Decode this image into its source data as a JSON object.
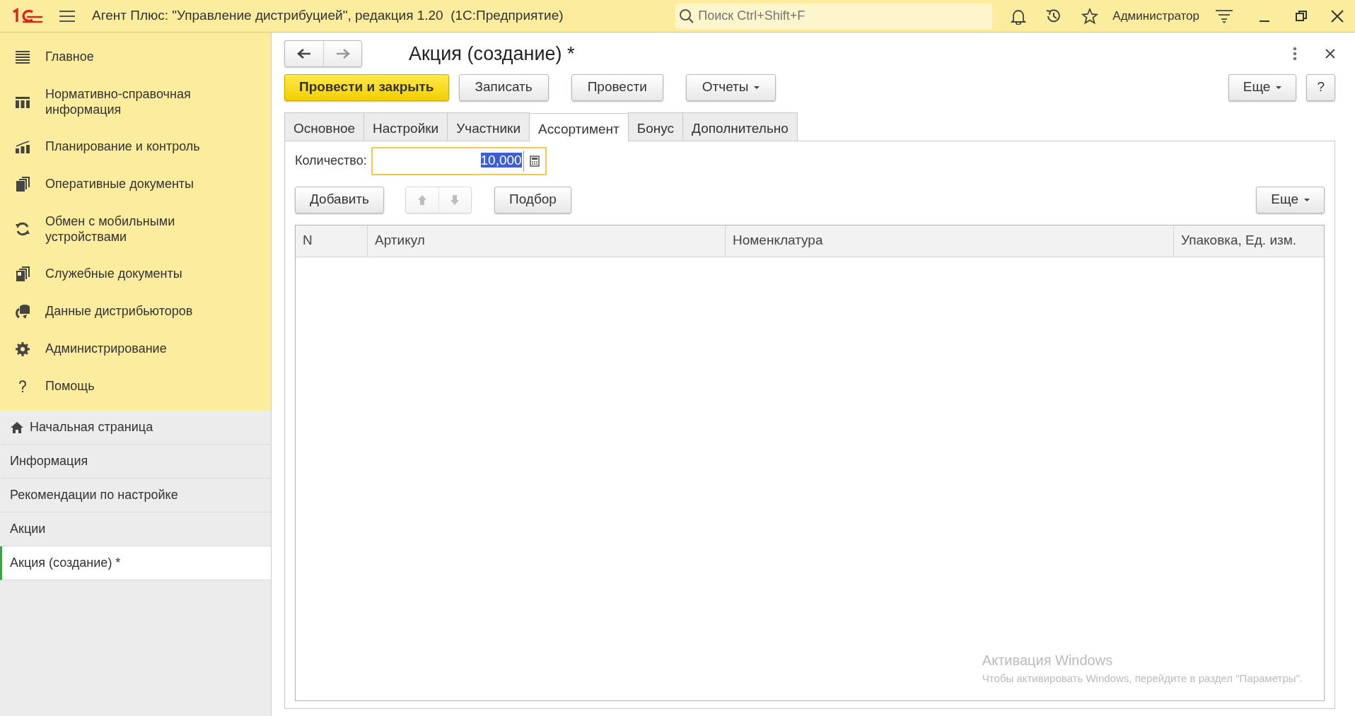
{
  "app": {
    "title": "Агент Плюс: \"Управление дистрибуцией\", редакция 1.20  (1С:Предприятие)",
    "search": {
      "placeholder": "Поиск Ctrl+Shift+F"
    },
    "user": "Администратор"
  },
  "sections": [
    {
      "label": "Главное"
    },
    {
      "label": "Нормативно-справочная информация"
    },
    {
      "label": "Планирование и контроль"
    },
    {
      "label": "Оперативные документы"
    },
    {
      "label": "Обмен с мобильными устройствами"
    },
    {
      "label": "Служебные документы"
    },
    {
      "label": "Данные дистрибьюторов"
    },
    {
      "label": "Администрирование"
    },
    {
      "label": "Помощь"
    }
  ],
  "open_windows": [
    {
      "label": "Начальная страница",
      "kind": "home",
      "selected": false
    },
    {
      "label": "Информация",
      "kind": "page",
      "selected": false
    },
    {
      "label": "Рекомендации по настройке",
      "kind": "page",
      "selected": false
    },
    {
      "label": "Акции",
      "kind": "page",
      "selected": false
    },
    {
      "label": "Акция (создание) *",
      "kind": "page",
      "selected": true
    }
  ],
  "form": {
    "title": "Акция (создание) *",
    "commands": [
      {
        "label": "Провести и закрыть",
        "kind": "default"
      },
      {
        "label": "Записать",
        "kind": "plain"
      },
      {
        "label": "Провести",
        "kind": "plain"
      },
      {
        "label": "Отчеты",
        "kind": "menu"
      }
    ],
    "more": "Еще",
    "help": "?",
    "tabs": [
      {
        "label": "Основное",
        "selected": false
      },
      {
        "label": "Настройки",
        "selected": false
      },
      {
        "label": "Участники",
        "selected": false
      },
      {
        "label": "Ассортимент",
        "selected": true
      },
      {
        "label": "Бонус",
        "selected": false
      },
      {
        "label": "Дополнительно",
        "selected": false
      }
    ],
    "quantity": {
      "label": "Количество:",
      "value": "10,000"
    },
    "table_commands": {
      "add": "Добавить",
      "pick": "Подбор",
      "more": "Еще",
      "move_disabled": true
    },
    "table": {
      "columns": [
        "N",
        "Артикул",
        "Номенклатура",
        "Упаковка, Ед. изм."
      ]
    }
  },
  "activation": {
    "title": "Активация Windows",
    "text": "Чтобы активировать Windows, перейдите в раздел \"Параметры\"."
  }
}
